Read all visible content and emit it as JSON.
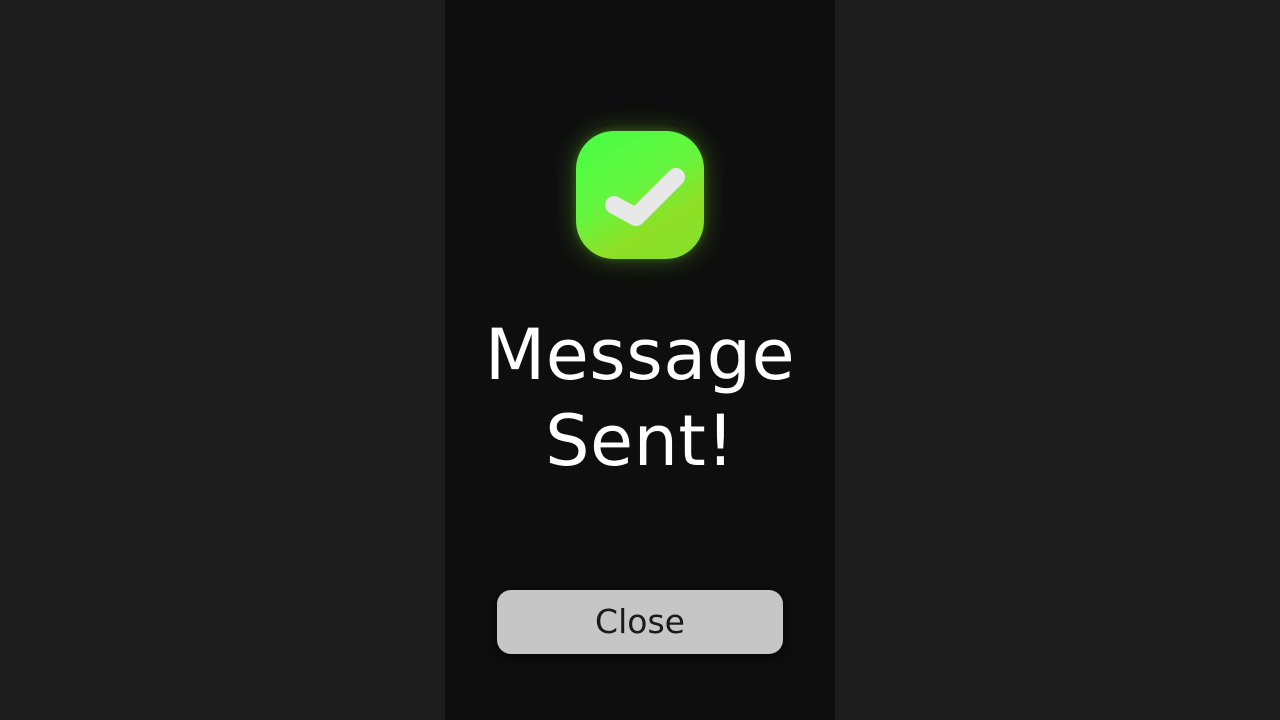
{
  "dialog": {
    "icon": "checkmark-icon",
    "title": "Message Sent!",
    "close_label": "Close"
  },
  "colors": {
    "background": "#1c1c1c",
    "panel": "#0e0e0e",
    "success_gradient_start": "#45ff45",
    "success_gradient_end": "#8edf26",
    "check": "#e8e8e8",
    "button_bg": "#c6c6c6",
    "button_text": "#1a1a1a",
    "title_text": "#ffffff"
  }
}
